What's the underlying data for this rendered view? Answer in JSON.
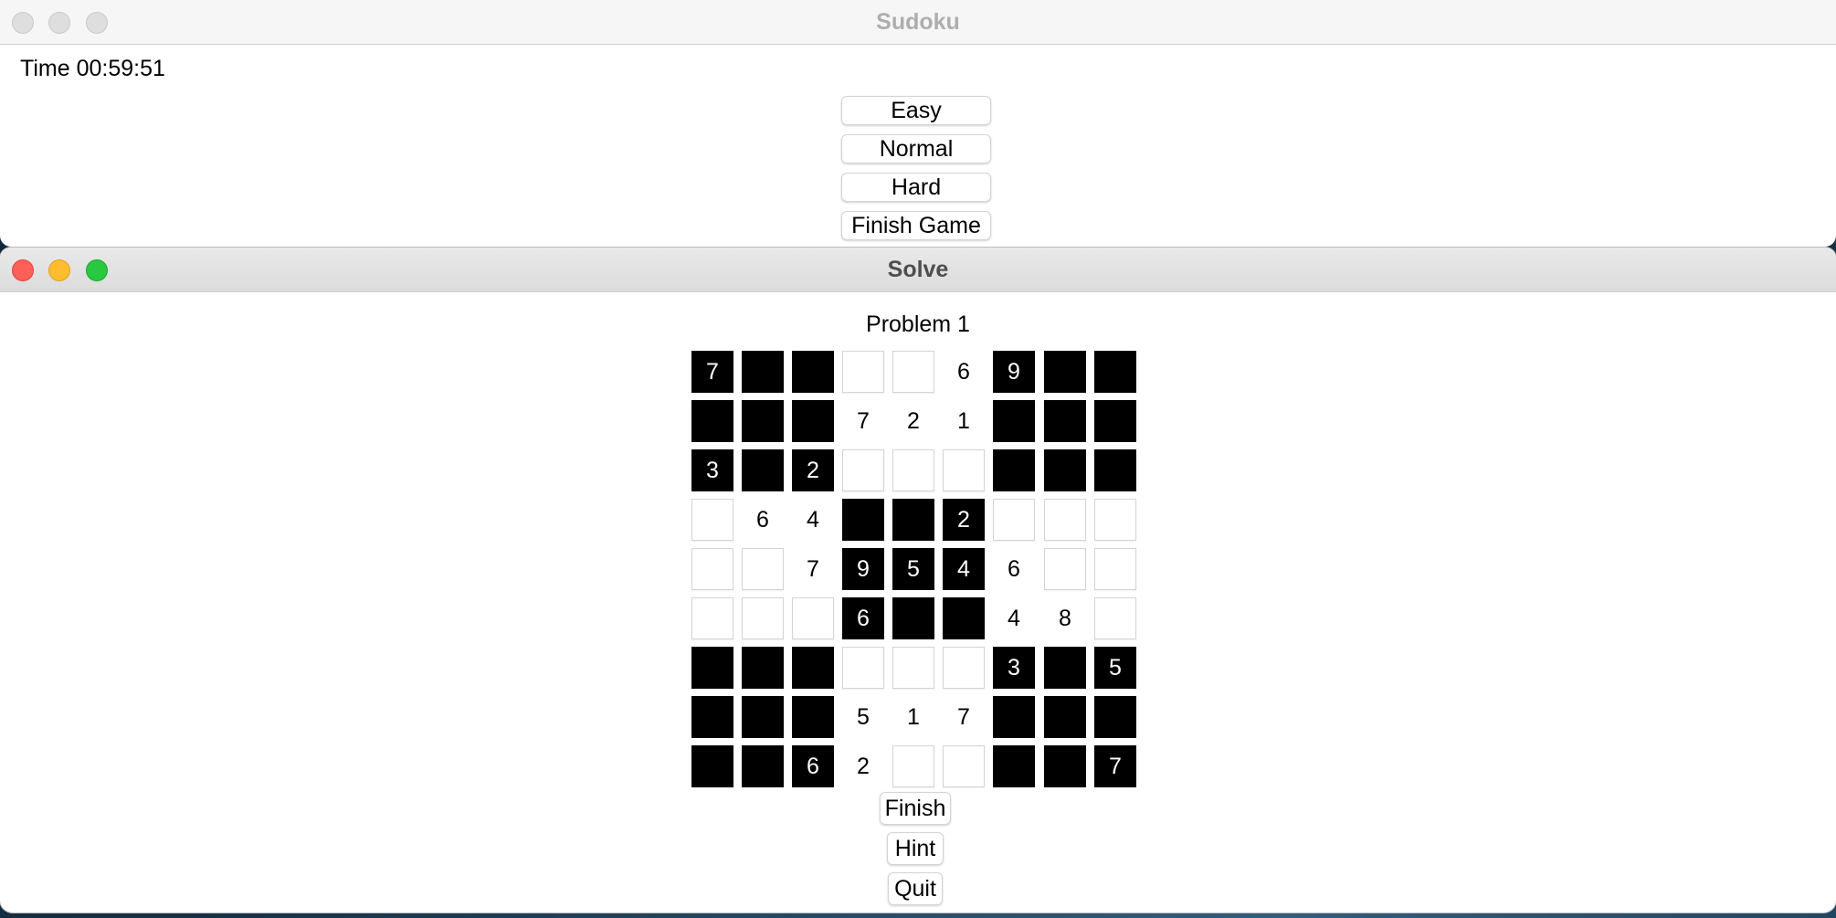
{
  "main_window": {
    "title": "Sudoku",
    "time_label": "Time 00:59:51",
    "buttons": {
      "easy": "Easy",
      "normal": "Normal",
      "hard": "Hard",
      "finish_game": "Finish Game"
    }
  },
  "solve_window": {
    "title": "Solve",
    "problem_label": "Problem 1",
    "grid": [
      [
        {
          "t": "b",
          "v": "7"
        },
        {
          "t": "b",
          "v": ""
        },
        {
          "t": "b",
          "v": ""
        },
        {
          "t": "e",
          "v": ""
        },
        {
          "t": "e",
          "v": ""
        },
        {
          "t": "g",
          "v": "6"
        },
        {
          "t": "b",
          "v": "9"
        },
        {
          "t": "b",
          "v": ""
        },
        {
          "t": "b",
          "v": ""
        }
      ],
      [
        {
          "t": "b",
          "v": ""
        },
        {
          "t": "b",
          "v": ""
        },
        {
          "t": "b",
          "v": ""
        },
        {
          "t": "g",
          "v": "7"
        },
        {
          "t": "g",
          "v": "2"
        },
        {
          "t": "g",
          "v": "1"
        },
        {
          "t": "b",
          "v": ""
        },
        {
          "t": "b",
          "v": ""
        },
        {
          "t": "b",
          "v": ""
        }
      ],
      [
        {
          "t": "b",
          "v": "3"
        },
        {
          "t": "b",
          "v": ""
        },
        {
          "t": "b",
          "v": "2"
        },
        {
          "t": "e",
          "v": ""
        },
        {
          "t": "e",
          "v": ""
        },
        {
          "t": "e",
          "v": ""
        },
        {
          "t": "b",
          "v": ""
        },
        {
          "t": "b",
          "v": ""
        },
        {
          "t": "b",
          "v": ""
        }
      ],
      [
        {
          "t": "e",
          "v": ""
        },
        {
          "t": "g",
          "v": "6"
        },
        {
          "t": "g",
          "v": "4"
        },
        {
          "t": "b",
          "v": ""
        },
        {
          "t": "b",
          "v": ""
        },
        {
          "t": "b",
          "v": "2"
        },
        {
          "t": "e",
          "v": ""
        },
        {
          "t": "e",
          "v": ""
        },
        {
          "t": "e",
          "v": ""
        }
      ],
      [
        {
          "t": "e",
          "v": ""
        },
        {
          "t": "e",
          "v": ""
        },
        {
          "t": "g",
          "v": "7"
        },
        {
          "t": "b",
          "v": "9"
        },
        {
          "t": "b",
          "v": "5"
        },
        {
          "t": "b",
          "v": "4"
        },
        {
          "t": "g",
          "v": "6"
        },
        {
          "t": "e",
          "v": ""
        },
        {
          "t": "e",
          "v": ""
        }
      ],
      [
        {
          "t": "e",
          "v": ""
        },
        {
          "t": "e",
          "v": ""
        },
        {
          "t": "e",
          "v": ""
        },
        {
          "t": "b",
          "v": "6"
        },
        {
          "t": "b",
          "v": ""
        },
        {
          "t": "b",
          "v": ""
        },
        {
          "t": "g",
          "v": "4"
        },
        {
          "t": "g",
          "v": "8"
        },
        {
          "t": "e",
          "v": ""
        }
      ],
      [
        {
          "t": "b",
          "v": ""
        },
        {
          "t": "b",
          "v": ""
        },
        {
          "t": "b",
          "v": ""
        },
        {
          "t": "e",
          "v": ""
        },
        {
          "t": "e",
          "v": ""
        },
        {
          "t": "e",
          "v": ""
        },
        {
          "t": "b",
          "v": "3"
        },
        {
          "t": "b",
          "v": ""
        },
        {
          "t": "b",
          "v": "5"
        }
      ],
      [
        {
          "t": "b",
          "v": ""
        },
        {
          "t": "b",
          "v": ""
        },
        {
          "t": "b",
          "v": ""
        },
        {
          "t": "g",
          "v": "5"
        },
        {
          "t": "g",
          "v": "1"
        },
        {
          "t": "g",
          "v": "7"
        },
        {
          "t": "b",
          "v": ""
        },
        {
          "t": "b",
          "v": ""
        },
        {
          "t": "b",
          "v": ""
        }
      ],
      [
        {
          "t": "b",
          "v": ""
        },
        {
          "t": "b",
          "v": ""
        },
        {
          "t": "b",
          "v": "6"
        },
        {
          "t": "g",
          "v": "2"
        },
        {
          "t": "e",
          "v": ""
        },
        {
          "t": "e",
          "v": ""
        },
        {
          "t": "b",
          "v": ""
        },
        {
          "t": "b",
          "v": ""
        },
        {
          "t": "b",
          "v": "7"
        }
      ]
    ],
    "buttons": {
      "finish": "Finish",
      "hint": "Hint",
      "quit": "Quit"
    }
  }
}
